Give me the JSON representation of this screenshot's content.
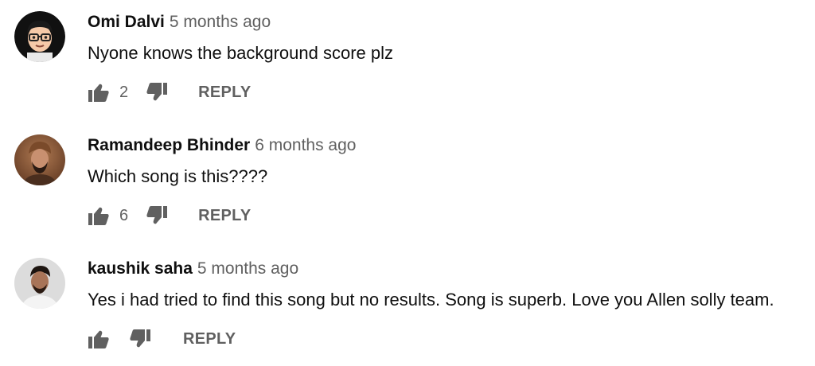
{
  "comments": [
    {
      "author": "Omi Dalvi",
      "time": "5 months ago",
      "text": "Nyone knows the background score plz",
      "likes": "2",
      "reply_label": "REPLY",
      "avatar_icon": "cartoon-avatar-icon"
    },
    {
      "author": "Ramandeep Bhinder",
      "time": "6 months ago",
      "text": "Which song is this????",
      "likes": "6",
      "reply_label": "REPLY",
      "avatar_icon": "photo-avatar-icon"
    },
    {
      "author": "kaushik saha",
      "time": "5 months ago",
      "text": "Yes i had tried to find this song but no results. Song is superb. Love you Allen solly team.",
      "likes": "",
      "reply_label": "REPLY",
      "avatar_icon": "photo-avatar-icon"
    }
  ],
  "colors": {
    "text_primary": "#0f0f0f",
    "text_secondary": "#606060",
    "icon": "#606060"
  }
}
